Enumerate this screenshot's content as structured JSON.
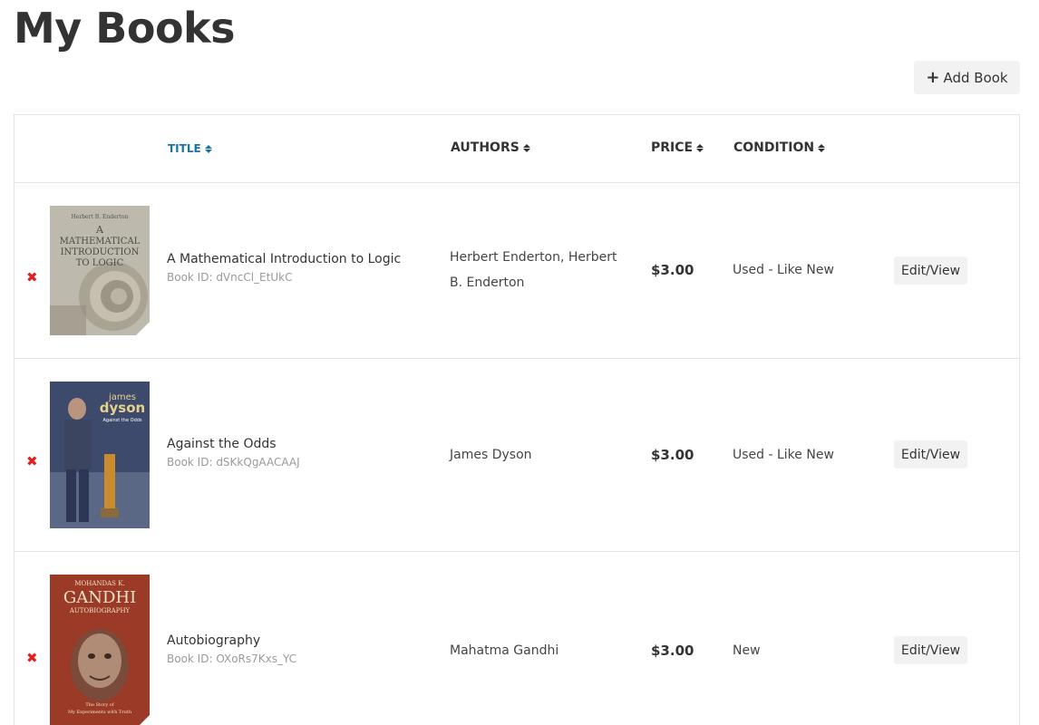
{
  "page": {
    "title": "My Books"
  },
  "toolbar": {
    "add_label": "Add Book"
  },
  "table": {
    "headers": {
      "title": "TITLE",
      "authors": "AUTHORS",
      "price": "PRICE",
      "condition": "CONDITION"
    },
    "rows": [
      {
        "title": "A Mathematical Introduction to Logic",
        "book_id": "Book ID: dVncCl_EtUkC",
        "authors": "Herbert Enderton, Herbert B. Enderton",
        "price": "$3.00",
        "condition": "Used - Like New",
        "action": "Edit/View",
        "delete": "✖",
        "cover": {
          "line1": "Herbert B. Enderton",
          "line2": "A",
          "line3": "MATHEMATICAL",
          "line4": "INTRODUCTION",
          "line5": "TO LOGIC"
        }
      },
      {
        "title": "Against the Odds",
        "book_id": "Book ID: dSKkQgAACAAJ",
        "authors": "James Dyson",
        "price": "$3.00",
        "condition": "Used - Like New",
        "action": "Edit/View",
        "delete": "✖",
        "cover": {
          "line1": "james",
          "line2": "dyson",
          "line3": "Against the Odds"
        }
      },
      {
        "title": "Autobiography",
        "book_id": "Book ID: OXoRs7Kxs_YC",
        "authors": "Mahatma Gandhi",
        "price": "$3.00",
        "condition": "New",
        "action": "Edit/View",
        "delete": "✖",
        "cover": {
          "line1": "MOHANDAS K.",
          "line2": "GANDHI",
          "line3": "AUTOBIOGRAPHY",
          "line4": "The Story of",
          "line5": "My Experiments with Truth"
        }
      }
    ]
  }
}
